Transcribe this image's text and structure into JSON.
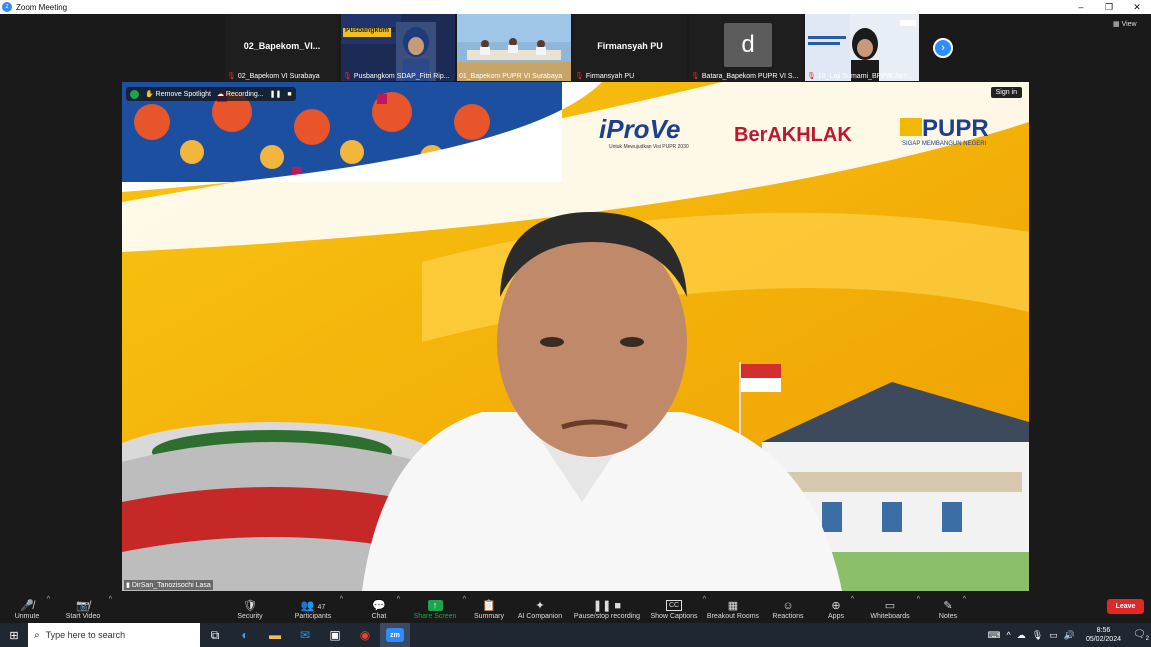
{
  "window": {
    "title": "Zoom Meeting",
    "controls": [
      "–",
      "❐",
      "✕"
    ]
  },
  "thumbnails": [
    {
      "display": "02_Bapekom_VI...",
      "label": "02_Bapekom VI Surabaya",
      "muted": true,
      "kind": "name"
    },
    {
      "display": "",
      "label": "Pusbangkom SDAP_Fitri Rip...",
      "muted": true,
      "kind": "video",
      "overlay_text": "Pusbangkom S"
    },
    {
      "display": "",
      "label": "01_Bapekom PUPR VI Surabaya",
      "muted": false,
      "kind": "video"
    },
    {
      "display": "Firmansyah PU",
      "label": "Firmansyah PU",
      "muted": true,
      "kind": "name"
    },
    {
      "display": "d",
      "label": "Batara_Bapekom PUPR VI S...",
      "muted": true,
      "kind": "avatar"
    },
    {
      "display": "",
      "label": "18_Laji Sumami_BPPW Jam...",
      "muted": true,
      "kind": "video"
    }
  ],
  "strip_next_icon": "chevron-right-icon",
  "view_label": "View",
  "main_video": {
    "overlay": {
      "remove_spotlight": "Remove Spotlight",
      "recording": "Recording...",
      "pause": "❚❚",
      "stop": "■"
    },
    "sign_in": "Sign in",
    "speaker": "DirSan_Tanozisochi Lasa",
    "banner": {
      "iprove": "iProVe",
      "iprove_sub": "Untuk Mewujudkan Visi PUPR 2030",
      "berakhlak": "BerAKHLAK",
      "pupr": "PUPR",
      "pupr_sub": "SIGAP MEMBANGUN NEGERI"
    }
  },
  "controls": [
    {
      "label": "Unmute",
      "icon": "🎤̸",
      "caret": true
    },
    {
      "label": "Start Video",
      "icon": "📷̸",
      "caret": true
    },
    {
      "label": "Security",
      "icon": "🛡",
      "caret": false
    },
    {
      "label": "Participants",
      "icon": "👥",
      "count": "47",
      "caret": true
    },
    {
      "label": "Chat",
      "icon": "💬",
      "caret": true
    },
    {
      "label": "Share Screen",
      "icon": "↑",
      "caret": true
    },
    {
      "label": "Summary",
      "icon": "📋",
      "caret": false
    },
    {
      "label": "AI Companion",
      "icon": "✦",
      "caret": false
    },
    {
      "label": "Pause/stop recording",
      "icon": "❚❚ ■",
      "caret": false
    },
    {
      "label": "Show Captions",
      "icon": "CC",
      "caret": true
    },
    {
      "label": "Breakout Rooms",
      "icon": "▦",
      "caret": false
    },
    {
      "label": "Reactions",
      "icon": "☺",
      "caret": false
    },
    {
      "label": "Apps",
      "icon": "⊕",
      "caret": true
    },
    {
      "label": "Whiteboards",
      "icon": "▭",
      "caret": true
    },
    {
      "label": "Notes",
      "icon": "✎",
      "caret": true
    }
  ],
  "leave_label": "Leave",
  "taskbar": {
    "search_placeholder": "Type here to search",
    "time": "8:56",
    "date": "05/02/2024",
    "notifications": "2"
  },
  "colors": {
    "zoom_blue": "#2d8cff",
    "leave_red": "#e02828",
    "share_green": "#1ea44a",
    "banner_yellow": "#f5b400"
  }
}
